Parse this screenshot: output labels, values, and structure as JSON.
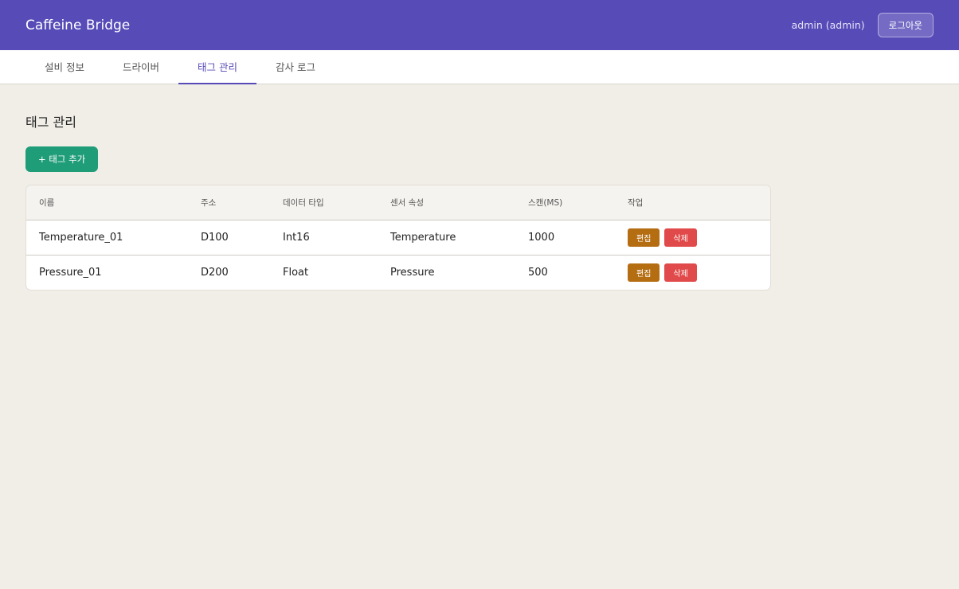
{
  "header": {
    "title": "Caffeine Bridge",
    "user": "admin (admin)",
    "logout_label": "로그아웃"
  },
  "tabs": [
    {
      "label": "설비 정보",
      "active": false
    },
    {
      "label": "드라이버",
      "active": false
    },
    {
      "label": "태그 관리",
      "active": true
    },
    {
      "label": "감사 로그",
      "active": false
    }
  ],
  "main": {
    "title": "태그 관리",
    "add_button_label": "+ 태그 추가",
    "table": {
      "columns": [
        "이름",
        "주소",
        "데이터 타입",
        "센서 속성",
        "스캔(MS)",
        "작업"
      ],
      "rows": [
        {
          "name": "Temperature_01",
          "address": "D100",
          "data_type": "Int16",
          "sensor_attr": "Temperature",
          "scan": "1000",
          "edit_label": "편집",
          "delete_label": "삭제"
        },
        {
          "name": "Pressure_01",
          "address": "D200",
          "data_type": "Float",
          "sensor_attr": "Pressure",
          "scan": "500",
          "edit_label": "편집",
          "delete_label": "삭제"
        }
      ]
    }
  },
  "colors": {
    "header_bg": "#574bb8",
    "page_bg": "#f1eee7",
    "add_button": "#1f9d78",
    "edit_button": "#b56d12",
    "delete_button": "#e14a4a"
  }
}
